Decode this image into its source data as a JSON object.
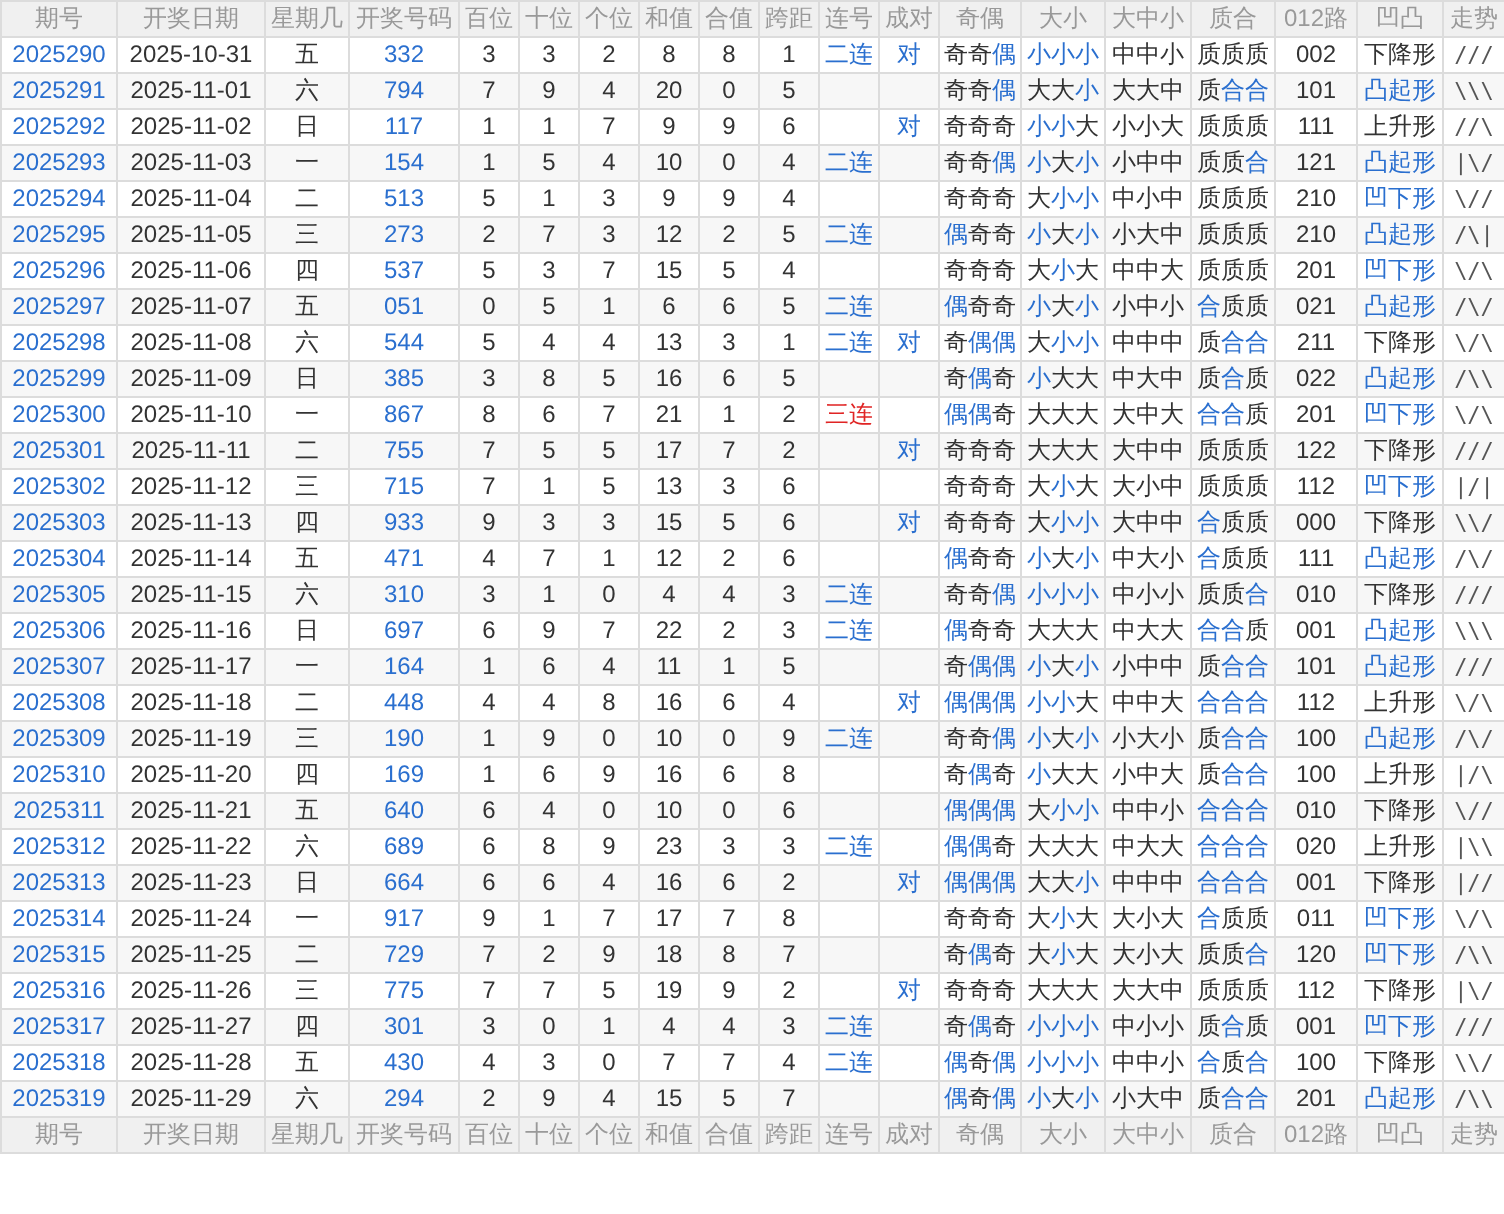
{
  "columns_top": [
    "期号",
    "开奖日期",
    "星期几",
    "开奖号码",
    "百位",
    "十位",
    "个位",
    "和值",
    "合值",
    "跨距",
    "连号",
    "成对",
    "奇偶",
    "大小",
    "大中小",
    "质合",
    "012路",
    "凹凸",
    "走势"
  ],
  "rows": [
    {
      "issue": "2025290",
      "date": "2025-10-31",
      "weekday": "五",
      "number": "332",
      "hundreds": "3",
      "tens": "3",
      "ones": "2",
      "sum": "8",
      "sum_tail": "8",
      "span": "1",
      "consecutive": {
        "text": "二连",
        "color": "#2a6fcf"
      },
      "pair": "对",
      "parity": {
        "text": "奇奇偶",
        "highlight": [
          false,
          false,
          true
        ]
      },
      "size": {
        "text": "小小小",
        "highlight": [
          true,
          true,
          true
        ]
      },
      "range": "中中小",
      "prime": {
        "text": "质质质",
        "highlight": [
          false,
          false,
          false
        ]
      },
      "route": "002",
      "shape": {
        "text": "下降形",
        "highlight": false
      },
      "trend": "///"
    },
    {
      "issue": "2025291",
      "date": "2025-11-01",
      "weekday": "六",
      "number": "794",
      "hundreds": "7",
      "tens": "9",
      "ones": "4",
      "sum": "20",
      "sum_tail": "0",
      "span": "5",
      "parity": {
        "text": "奇奇偶",
        "highlight": [
          false,
          false,
          true
        ]
      },
      "size": {
        "text": "大大小",
        "highlight": [
          false,
          false,
          true
        ]
      },
      "range": "大大中",
      "prime": {
        "text": "质合合",
        "highlight": [
          false,
          true,
          true
        ]
      },
      "route": "101",
      "shape": {
        "text": "凸起形",
        "highlight": true
      },
      "trend": "\\\\\\"
    },
    {
      "issue": "2025292",
      "date": "2025-11-02",
      "weekday": "日",
      "number": "117",
      "hundreds": "1",
      "tens": "1",
      "ones": "7",
      "sum": "9",
      "sum_tail": "9",
      "span": "6",
      "pair": "对",
      "parity": {
        "text": "奇奇奇",
        "highlight": [
          false,
          false,
          false
        ]
      },
      "size": {
        "text": "小小大",
        "highlight": [
          true,
          true,
          false
        ]
      },
      "range": "小小大",
      "prime": {
        "text": "质质质",
        "highlight": [
          false,
          false,
          false
        ]
      },
      "route": "111",
      "shape": {
        "text": "上升形",
        "highlight": false
      },
      "trend": "//\\"
    },
    {
      "issue": "2025293",
      "date": "2025-11-03",
      "weekday": "一",
      "number": "154",
      "hundreds": "1",
      "tens": "5",
      "ones": "4",
      "sum": "10",
      "sum_tail": "0",
      "span": "4",
      "consecutive": {
        "text": "二连",
        "color": "#2a6fcf"
      },
      "parity": {
        "text": "奇奇偶",
        "highlight": [
          false,
          false,
          true
        ]
      },
      "size": {
        "text": "小大小",
        "highlight": [
          true,
          false,
          true
        ]
      },
      "range": "小中中",
      "prime": {
        "text": "质质合",
        "highlight": [
          false,
          false,
          true
        ]
      },
      "route": "121",
      "shape": {
        "text": "凸起形",
        "highlight": true
      },
      "trend": "|\\/"
    },
    {
      "issue": "2025294",
      "date": "2025-11-04",
      "weekday": "二",
      "number": "513",
      "hundreds": "5",
      "tens": "1",
      "ones": "3",
      "sum": "9",
      "sum_tail": "9",
      "span": "4",
      "parity": {
        "text": "奇奇奇",
        "highlight": [
          false,
          false,
          false
        ]
      },
      "size": {
        "text": "大小小",
        "highlight": [
          false,
          true,
          true
        ]
      },
      "range": "中小中",
      "prime": {
        "text": "质质质",
        "highlight": [
          false,
          false,
          false
        ]
      },
      "route": "210",
      "shape": {
        "text": "凹下形",
        "highlight": true
      },
      "trend": "\\//"
    },
    {
      "issue": "2025295",
      "date": "2025-11-05",
      "weekday": "三",
      "number": "273",
      "hundreds": "2",
      "tens": "7",
      "ones": "3",
      "sum": "12",
      "sum_tail": "2",
      "span": "5",
      "consecutive": {
        "text": "二连",
        "color": "#2a6fcf"
      },
      "parity": {
        "text": "偶奇奇",
        "highlight": [
          true,
          false,
          false
        ]
      },
      "size": {
        "text": "小大小",
        "highlight": [
          true,
          false,
          true
        ]
      },
      "range": "小大中",
      "prime": {
        "text": "质质质",
        "highlight": [
          false,
          false,
          false
        ]
      },
      "route": "210",
      "shape": {
        "text": "凸起形",
        "highlight": true
      },
      "trend": "/\\|"
    },
    {
      "issue": "2025296",
      "date": "2025-11-06",
      "weekday": "四",
      "number": "537",
      "hundreds": "5",
      "tens": "3",
      "ones": "7",
      "sum": "15",
      "sum_tail": "5",
      "span": "4",
      "parity": {
        "text": "奇奇奇",
        "highlight": [
          false,
          false,
          false
        ]
      },
      "size": {
        "text": "大小大",
        "highlight": [
          false,
          true,
          false
        ]
      },
      "range": "中中大",
      "prime": {
        "text": "质质质",
        "highlight": [
          false,
          false,
          false
        ]
      },
      "route": "201",
      "shape": {
        "text": "凹下形",
        "highlight": true
      },
      "trend": "\\/\\"
    },
    {
      "issue": "2025297",
      "date": "2025-11-07",
      "weekday": "五",
      "number": "051",
      "hundreds": "0",
      "tens": "5",
      "ones": "1",
      "sum": "6",
      "sum_tail": "6",
      "span": "5",
      "consecutive": {
        "text": "二连",
        "color": "#2a6fcf"
      },
      "parity": {
        "text": "偶奇奇",
        "highlight": [
          true,
          false,
          false
        ]
      },
      "size": {
        "text": "小大小",
        "highlight": [
          true,
          false,
          true
        ]
      },
      "range": "小中小",
      "prime": {
        "text": "合质质",
        "highlight": [
          true,
          false,
          false
        ]
      },
      "route": "021",
      "shape": {
        "text": "凸起形",
        "highlight": true
      },
      "trend": "/\\/"
    },
    {
      "issue": "2025298",
      "date": "2025-11-08",
      "weekday": "六",
      "number": "544",
      "hundreds": "5",
      "tens": "4",
      "ones": "4",
      "sum": "13",
      "sum_tail": "3",
      "span": "1",
      "consecutive": {
        "text": "二连",
        "color": "#2a6fcf"
      },
      "pair": "对",
      "parity": {
        "text": "奇偶偶",
        "highlight": [
          false,
          true,
          true
        ]
      },
      "size": {
        "text": "大小小",
        "highlight": [
          false,
          true,
          true
        ]
      },
      "range": "中中中",
      "prime": {
        "text": "质合合",
        "highlight": [
          false,
          true,
          true
        ]
      },
      "route": "211",
      "shape": {
        "text": "下降形",
        "highlight": false
      },
      "trend": "\\/\\"
    },
    {
      "issue": "2025299",
      "date": "2025-11-09",
      "weekday": "日",
      "number": "385",
      "hundreds": "3",
      "tens": "8",
      "ones": "5",
      "sum": "16",
      "sum_tail": "6",
      "span": "5",
      "parity": {
        "text": "奇偶奇",
        "highlight": [
          false,
          true,
          false
        ]
      },
      "size": {
        "text": "小大大",
        "highlight": [
          true,
          false,
          false
        ]
      },
      "range": "中大中",
      "prime": {
        "text": "质合质",
        "highlight": [
          false,
          true,
          false
        ]
      },
      "route": "022",
      "shape": {
        "text": "凸起形",
        "highlight": true
      },
      "trend": "/\\\\"
    },
    {
      "issue": "2025300",
      "date": "2025-11-10",
      "weekday": "一",
      "number": "867",
      "hundreds": "8",
      "tens": "6",
      "ones": "7",
      "sum": "21",
      "sum_tail": "1",
      "span": "2",
      "consecutive": {
        "text": "三连",
        "color": "#e02424"
      },
      "parity": {
        "text": "偶偶奇",
        "highlight": [
          true,
          true,
          false
        ]
      },
      "size": {
        "text": "大大大",
        "highlight": [
          false,
          false,
          false
        ]
      },
      "range": "大中大",
      "prime": {
        "text": "合合质",
        "highlight": [
          true,
          true,
          false
        ]
      },
      "route": "201",
      "shape": {
        "text": "凹下形",
        "highlight": true
      },
      "trend": "\\/\\"
    },
    {
      "issue": "2025301",
      "date": "2025-11-11",
      "weekday": "二",
      "number": "755",
      "hundreds": "7",
      "tens": "5",
      "ones": "5",
      "sum": "17",
      "sum_tail": "7",
      "span": "2",
      "pair": "对",
      "parity": {
        "text": "奇奇奇",
        "highlight": [
          false,
          false,
          false
        ]
      },
      "size": {
        "text": "大大大",
        "highlight": [
          false,
          false,
          false
        ]
      },
      "range": "大中中",
      "prime": {
        "text": "质质质",
        "highlight": [
          false,
          false,
          false
        ]
      },
      "route": "122",
      "shape": {
        "text": "下降形",
        "highlight": false
      },
      "trend": "///"
    },
    {
      "issue": "2025302",
      "date": "2025-11-12",
      "weekday": "三",
      "number": "715",
      "hundreds": "7",
      "tens": "1",
      "ones": "5",
      "sum": "13",
      "sum_tail": "3",
      "span": "6",
      "parity": {
        "text": "奇奇奇",
        "highlight": [
          false,
          false,
          false
        ]
      },
      "size": {
        "text": "大小大",
        "highlight": [
          false,
          true,
          false
        ]
      },
      "range": "大小中",
      "prime": {
        "text": "质质质",
        "highlight": [
          false,
          false,
          false
        ]
      },
      "route": "112",
      "shape": {
        "text": "凹下形",
        "highlight": true
      },
      "trend": "|/|"
    },
    {
      "issue": "2025303",
      "date": "2025-11-13",
      "weekday": "四",
      "number": "933",
      "hundreds": "9",
      "tens": "3",
      "ones": "3",
      "sum": "15",
      "sum_tail": "5",
      "span": "6",
      "pair": "对",
      "parity": {
        "text": "奇奇奇",
        "highlight": [
          false,
          false,
          false
        ]
      },
      "size": {
        "text": "大小小",
        "highlight": [
          false,
          true,
          true
        ]
      },
      "range": "大中中",
      "prime": {
        "text": "合质质",
        "highlight": [
          true,
          false,
          false
        ]
      },
      "route": "000",
      "shape": {
        "text": "下降形",
        "highlight": false
      },
      "trend": "\\\\/"
    },
    {
      "issue": "2025304",
      "date": "2025-11-14",
      "weekday": "五",
      "number": "471",
      "hundreds": "4",
      "tens": "7",
      "ones": "1",
      "sum": "12",
      "sum_tail": "2",
      "span": "6",
      "parity": {
        "text": "偶奇奇",
        "highlight": [
          true,
          false,
          false
        ]
      },
      "size": {
        "text": "小大小",
        "highlight": [
          true,
          false,
          true
        ]
      },
      "range": "中大小",
      "prime": {
        "text": "合质质",
        "highlight": [
          true,
          false,
          false
        ]
      },
      "route": "111",
      "shape": {
        "text": "凸起形",
        "highlight": true
      },
      "trend": "/\\/"
    },
    {
      "issue": "2025305",
      "date": "2025-11-15",
      "weekday": "六",
      "number": "310",
      "hundreds": "3",
      "tens": "1",
      "ones": "0",
      "sum": "4",
      "sum_tail": "4",
      "span": "3",
      "consecutive": {
        "text": "二连",
        "color": "#2a6fcf"
      },
      "parity": {
        "text": "奇奇偶",
        "highlight": [
          false,
          false,
          true
        ]
      },
      "size": {
        "text": "小小小",
        "highlight": [
          true,
          true,
          true
        ]
      },
      "range": "中小小",
      "prime": {
        "text": "质质合",
        "highlight": [
          false,
          false,
          true
        ]
      },
      "route": "010",
      "shape": {
        "text": "下降形",
        "highlight": false
      },
      "trend": "///"
    },
    {
      "issue": "2025306",
      "date": "2025-11-16",
      "weekday": "日",
      "number": "697",
      "hundreds": "6",
      "tens": "9",
      "ones": "7",
      "sum": "22",
      "sum_tail": "2",
      "span": "3",
      "consecutive": {
        "text": "二连",
        "color": "#2a6fcf"
      },
      "parity": {
        "text": "偶奇奇",
        "highlight": [
          true,
          false,
          false
        ]
      },
      "size": {
        "text": "大大大",
        "highlight": [
          false,
          false,
          false
        ]
      },
      "range": "中大大",
      "prime": {
        "text": "合合质",
        "highlight": [
          true,
          true,
          false
        ]
      },
      "route": "001",
      "shape": {
        "text": "凸起形",
        "highlight": true
      },
      "trend": "\\\\\\"
    },
    {
      "issue": "2025307",
      "date": "2025-11-17",
      "weekday": "一",
      "number": "164",
      "hundreds": "1",
      "tens": "6",
      "ones": "4",
      "sum": "11",
      "sum_tail": "1",
      "span": "5",
      "parity": {
        "text": "奇偶偶",
        "highlight": [
          false,
          true,
          true
        ]
      },
      "size": {
        "text": "小大小",
        "highlight": [
          true,
          false,
          true
        ]
      },
      "range": "小中中",
      "prime": {
        "text": "质合合",
        "highlight": [
          false,
          true,
          true
        ]
      },
      "route": "101",
      "shape": {
        "text": "凸起形",
        "highlight": true
      },
      "trend": "///"
    },
    {
      "issue": "2025308",
      "date": "2025-11-18",
      "weekday": "二",
      "number": "448",
      "hundreds": "4",
      "tens": "4",
      "ones": "8",
      "sum": "16",
      "sum_tail": "6",
      "span": "4",
      "pair": "对",
      "parity": {
        "text": "偶偶偶",
        "highlight": [
          true,
          true,
          true
        ]
      },
      "size": {
        "text": "小小大",
        "highlight": [
          true,
          true,
          false
        ]
      },
      "range": "中中大",
      "prime": {
        "text": "合合合",
        "highlight": [
          true,
          true,
          true
        ]
      },
      "route": "112",
      "shape": {
        "text": "上升形",
        "highlight": false
      },
      "trend": "\\/\\"
    },
    {
      "issue": "2025309",
      "date": "2025-11-19",
      "weekday": "三",
      "number": "190",
      "hundreds": "1",
      "tens": "9",
      "ones": "0",
      "sum": "10",
      "sum_tail": "0",
      "span": "9",
      "consecutive": {
        "text": "二连",
        "color": "#2a6fcf"
      },
      "parity": {
        "text": "奇奇偶",
        "highlight": [
          false,
          false,
          true
        ]
      },
      "size": {
        "text": "小大小",
        "highlight": [
          true,
          false,
          true
        ]
      },
      "range": "小大小",
      "prime": {
        "text": "质合合",
        "highlight": [
          false,
          true,
          true
        ]
      },
      "route": "100",
      "shape": {
        "text": "凸起形",
        "highlight": true
      },
      "trend": "/\\/"
    },
    {
      "issue": "2025310",
      "date": "2025-11-20",
      "weekday": "四",
      "number": "169",
      "hundreds": "1",
      "tens": "6",
      "ones": "9",
      "sum": "16",
      "sum_tail": "6",
      "span": "8",
      "parity": {
        "text": "奇偶奇",
        "highlight": [
          false,
          true,
          false
        ]
      },
      "size": {
        "text": "小大大",
        "highlight": [
          true,
          false,
          false
        ]
      },
      "range": "小中大",
      "prime": {
        "text": "质合合",
        "highlight": [
          false,
          true,
          true
        ]
      },
      "route": "100",
      "shape": {
        "text": "上升形",
        "highlight": false
      },
      "trend": "|/\\"
    },
    {
      "issue": "2025311",
      "date": "2025-11-21",
      "weekday": "五",
      "number": "640",
      "hundreds": "6",
      "tens": "4",
      "ones": "0",
      "sum": "10",
      "sum_tail": "0",
      "span": "6",
      "parity": {
        "text": "偶偶偶",
        "highlight": [
          true,
          true,
          true
        ]
      },
      "size": {
        "text": "大小小",
        "highlight": [
          false,
          true,
          true
        ]
      },
      "range": "中中小",
      "prime": {
        "text": "合合合",
        "highlight": [
          true,
          true,
          true
        ]
      },
      "route": "010",
      "shape": {
        "text": "下降形",
        "highlight": false
      },
      "trend": "\\//"
    },
    {
      "issue": "2025312",
      "date": "2025-11-22",
      "weekday": "六",
      "number": "689",
      "hundreds": "6",
      "tens": "8",
      "ones": "9",
      "sum": "23",
      "sum_tail": "3",
      "span": "3",
      "consecutive": {
        "text": "二连",
        "color": "#2a6fcf"
      },
      "parity": {
        "text": "偶偶奇",
        "highlight": [
          true,
          true,
          false
        ]
      },
      "size": {
        "text": "大大大",
        "highlight": [
          false,
          false,
          false
        ]
      },
      "range": "中大大",
      "prime": {
        "text": "合合合",
        "highlight": [
          true,
          true,
          true
        ]
      },
      "route": "020",
      "shape": {
        "text": "上升形",
        "highlight": false
      },
      "trend": "|\\\\"
    },
    {
      "issue": "2025313",
      "date": "2025-11-23",
      "weekday": "日",
      "number": "664",
      "hundreds": "6",
      "tens": "6",
      "ones": "4",
      "sum": "16",
      "sum_tail": "6",
      "span": "2",
      "pair": "对",
      "parity": {
        "text": "偶偶偶",
        "highlight": [
          true,
          true,
          true
        ]
      },
      "size": {
        "text": "大大小",
        "highlight": [
          false,
          false,
          true
        ]
      },
      "range": "中中中",
      "prime": {
        "text": "合合合",
        "highlight": [
          true,
          true,
          true
        ]
      },
      "route": "001",
      "shape": {
        "text": "下降形",
        "highlight": false
      },
      "trend": "|//"
    },
    {
      "issue": "2025314",
      "date": "2025-11-24",
      "weekday": "一",
      "number": "917",
      "hundreds": "9",
      "tens": "1",
      "ones": "7",
      "sum": "17",
      "sum_tail": "7",
      "span": "8",
      "parity": {
        "text": "奇奇奇",
        "highlight": [
          false,
          false,
          false
        ]
      },
      "size": {
        "text": "大小大",
        "highlight": [
          false,
          true,
          false
        ]
      },
      "range": "大小大",
      "prime": {
        "text": "合质质",
        "highlight": [
          true,
          false,
          false
        ]
      },
      "route": "011",
      "shape": {
        "text": "凹下形",
        "highlight": true
      },
      "trend": "\\/\\"
    },
    {
      "issue": "2025315",
      "date": "2025-11-25",
      "weekday": "二",
      "number": "729",
      "hundreds": "7",
      "tens": "2",
      "ones": "9",
      "sum": "18",
      "sum_tail": "8",
      "span": "7",
      "parity": {
        "text": "奇偶奇",
        "highlight": [
          false,
          true,
          false
        ]
      },
      "size": {
        "text": "大小大",
        "highlight": [
          false,
          true,
          false
        ]
      },
      "range": "大小大",
      "prime": {
        "text": "质质合",
        "highlight": [
          false,
          false,
          true
        ]
      },
      "route": "120",
      "shape": {
        "text": "凹下形",
        "highlight": true
      },
      "trend": "/\\\\"
    },
    {
      "issue": "2025316",
      "date": "2025-11-26",
      "weekday": "三",
      "number": "775",
      "hundreds": "7",
      "tens": "7",
      "ones": "5",
      "sum": "19",
      "sum_tail": "9",
      "span": "2",
      "pair": "对",
      "parity": {
        "text": "奇奇奇",
        "highlight": [
          false,
          false,
          false
        ]
      },
      "size": {
        "text": "大大大",
        "highlight": [
          false,
          false,
          false
        ]
      },
      "range": "大大中",
      "prime": {
        "text": "质质质",
        "highlight": [
          false,
          false,
          false
        ]
      },
      "route": "112",
      "shape": {
        "text": "下降形",
        "highlight": false
      },
      "trend": "|\\/"
    },
    {
      "issue": "2025317",
      "date": "2025-11-27",
      "weekday": "四",
      "number": "301",
      "hundreds": "3",
      "tens": "0",
      "ones": "1",
      "sum": "4",
      "sum_tail": "4",
      "span": "3",
      "consecutive": {
        "text": "二连",
        "color": "#2a6fcf"
      },
      "parity": {
        "text": "奇偶奇",
        "highlight": [
          false,
          true,
          false
        ]
      },
      "size": {
        "text": "小小小",
        "highlight": [
          true,
          true,
          true
        ]
      },
      "range": "中小小",
      "prime": {
        "text": "质合质",
        "highlight": [
          false,
          true,
          false
        ]
      },
      "route": "001",
      "shape": {
        "text": "凹下形",
        "highlight": true
      },
      "trend": "///"
    },
    {
      "issue": "2025318",
      "date": "2025-11-28",
      "weekday": "五",
      "number": "430",
      "hundreds": "4",
      "tens": "3",
      "ones": "0",
      "sum": "7",
      "sum_tail": "7",
      "span": "4",
      "consecutive": {
        "text": "二连",
        "color": "#2a6fcf"
      },
      "parity": {
        "text": "偶奇偶",
        "highlight": [
          true,
          false,
          true
        ]
      },
      "size": {
        "text": "小小小",
        "highlight": [
          true,
          true,
          true
        ]
      },
      "range": "中中小",
      "prime": {
        "text": "合质合",
        "highlight": [
          true,
          false,
          true
        ]
      },
      "route": "100",
      "shape": {
        "text": "下降形",
        "highlight": false
      },
      "trend": "\\\\/"
    },
    {
      "issue": "2025319",
      "date": "2025-11-29",
      "weekday": "六",
      "number": "294",
      "hundreds": "2",
      "tens": "9",
      "ones": "4",
      "sum": "15",
      "sum_tail": "5",
      "span": "7",
      "parity": {
        "text": "偶奇偶",
        "highlight": [
          true,
          false,
          true
        ]
      },
      "size": {
        "text": "小大小",
        "highlight": [
          true,
          false,
          true
        ]
      },
      "range": "小大中",
      "prime": {
        "text": "质合合",
        "highlight": [
          false,
          true,
          true
        ]
      },
      "route": "201",
      "shape": {
        "text": "凸起形",
        "highlight": true
      },
      "trend": "/\\\\"
    }
  ],
  "columns_bottom": [
    "期号",
    "开奖日期",
    "星期几",
    "开奖号码",
    "百位",
    "十位",
    "个位",
    "和值",
    "合值",
    "跨距",
    "连号",
    "成对",
    "奇偶",
    "大小",
    "大中小",
    "质合",
    "012路",
    "凹凸",
    "走势"
  ]
}
